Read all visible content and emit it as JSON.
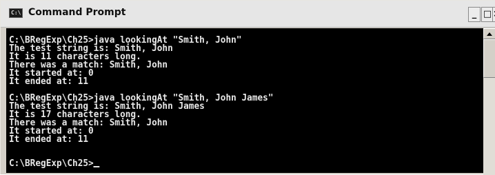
{
  "window": {
    "title": "Command Prompt",
    "icon_name": "console-icon",
    "icon_text": "C:\\",
    "controls": {
      "minimize": "_",
      "maximize": "□",
      "close": "×"
    }
  },
  "console": {
    "lines": [
      "C:\\BRegExp\\Ch25>java lookingAt \"Smith, John\"",
      "The test string is: Smith, John",
      "It is 11 characters long.",
      "There was a match: Smith, John",
      "It started at: 0",
      "It ended at: 11",
      "",
      "C:\\BRegExp\\Ch25>java lookingAt \"Smith, John James\"",
      "The test string is: Smith, John James",
      "It is 17 characters long.",
      "There was a match: Smith, John",
      "It started at: 0",
      "It ended at: 11",
      "",
      "C:\\BRegExp\\Ch25>"
    ],
    "colors": {
      "background": "#000000",
      "foreground": "#e8e8e8"
    }
  }
}
